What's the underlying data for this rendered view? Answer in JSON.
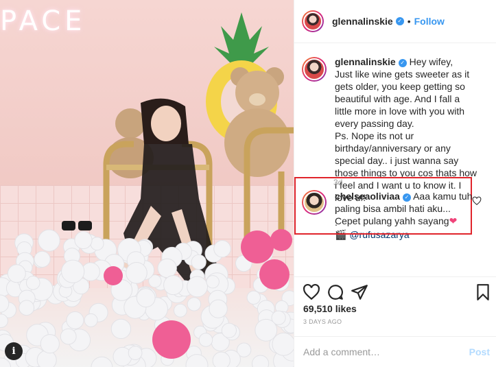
{
  "photo": {
    "neon_text": "PACE",
    "info_icon": "info-icon",
    "info_glyph": "i"
  },
  "header": {
    "username": "glennalinskie",
    "verified_glyph": "✓",
    "separator": "•",
    "follow_label": "Follow"
  },
  "caption": {
    "username": "glennalinskie",
    "lines": [
      "Hey wifey,",
      "Just like wine gets sweeter as it gets older, you keep getting so beautiful with age. And I fall a little more in love with you with every passing day.",
      "Ps. Nope its not ur birthday/anniversary or any special day.. i just wanna say those things to you cos thats how i feel and I want u to know it. I love u!!",
      ".",
      "."
    ],
    "mention_emoji": "🎬",
    "mention": "@rufusazarya",
    "age": "3d"
  },
  "comment": {
    "username": "chelseaoliviaa",
    "text": "Aaa kamu tuh paling bisa ambil hati aku... Cepet pulang yahh sayang",
    "heart_emoji": "❤"
  },
  "stats": {
    "likes": "69,510 likes",
    "date": "3 DAYS AGO"
  },
  "add_comment": {
    "placeholder": "Add a comment…",
    "post_label": "Post"
  },
  "colors": {
    "accent": "#3897f0",
    "highlight_border": "#e0242b",
    "heart": "#f0447a"
  }
}
